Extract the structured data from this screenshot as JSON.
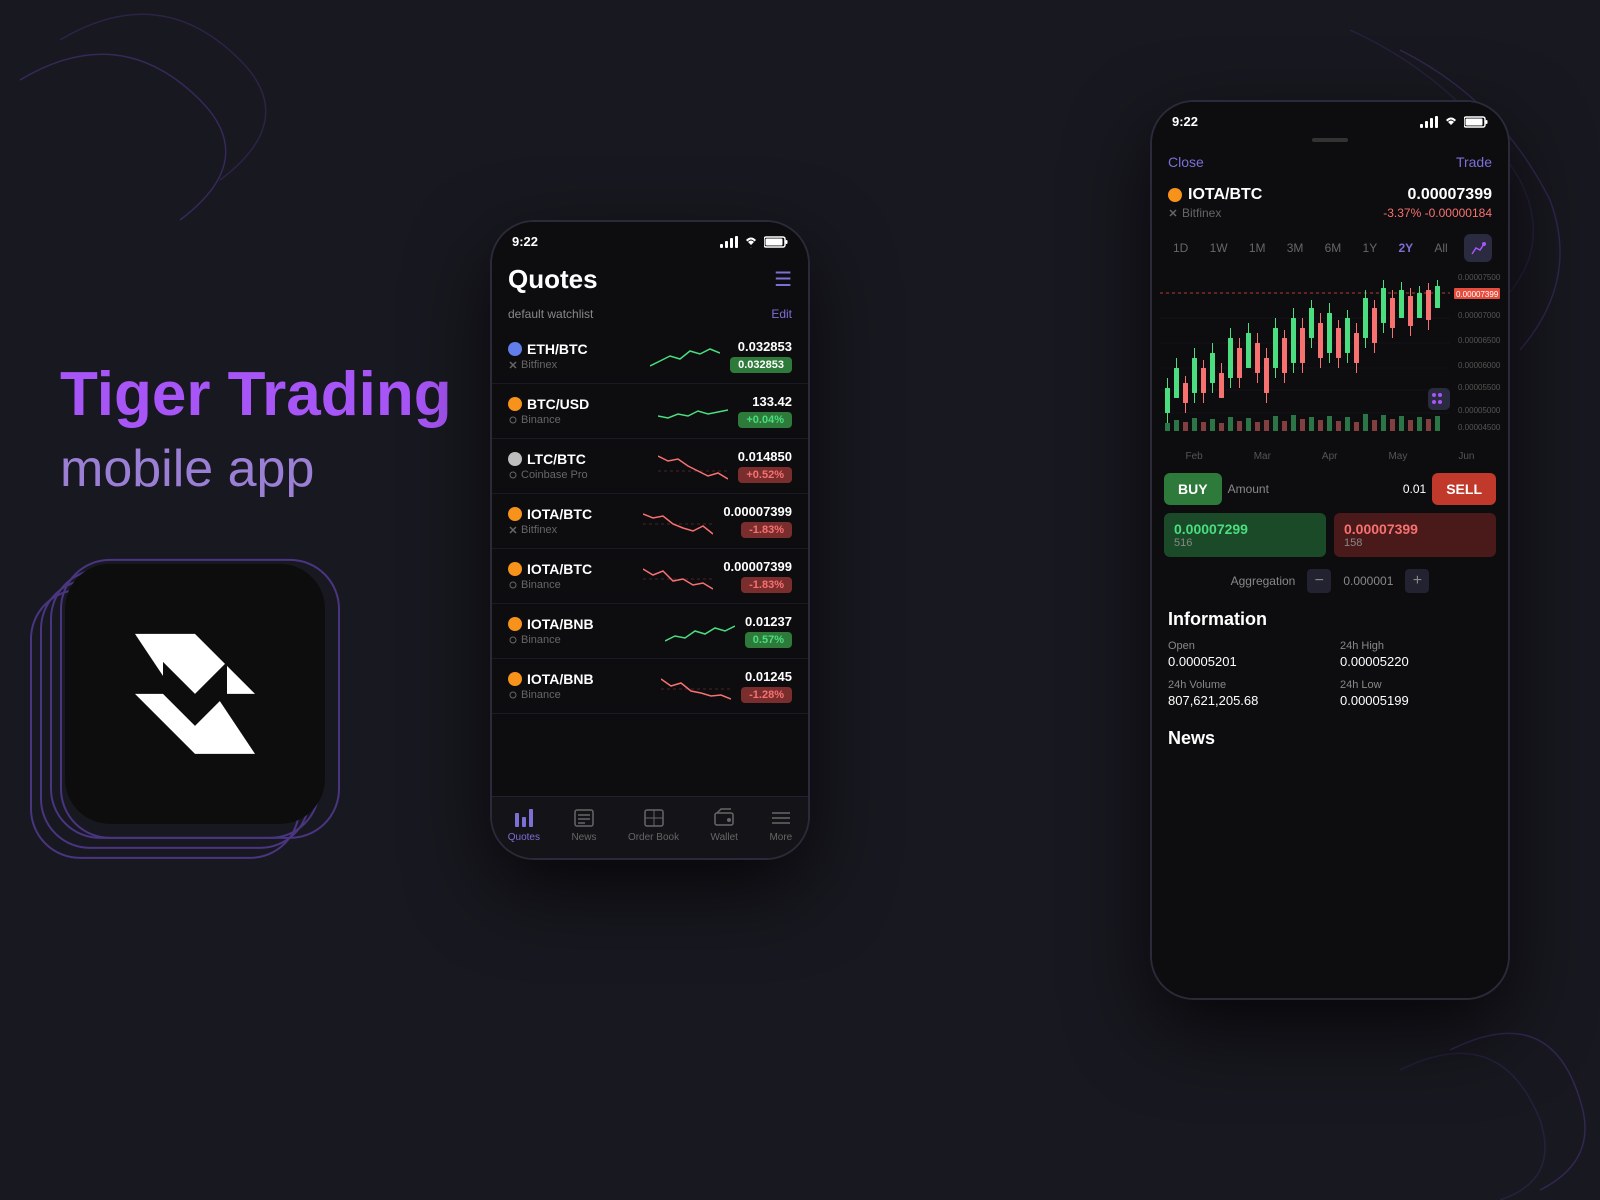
{
  "page": {
    "background": "#181820"
  },
  "branding": {
    "title_tiger": "Tiger Trading",
    "subtitle": "mobile app"
  },
  "phone1": {
    "status_time": "9:22",
    "screen_title": "Quotes",
    "watchlist_label": "default watchlist",
    "edit_label": "Edit",
    "quotes": [
      {
        "pair": "ETH/BTC",
        "exchange": "Bitfinex",
        "price": "0.032853",
        "change": "0.032853",
        "change_type": "green-flat",
        "coin_type": "eth"
      },
      {
        "pair": "BTC/USD",
        "exchange": "Binance",
        "price": "133.42",
        "change": "+0.04%",
        "change_type": "green",
        "coin_type": "btc"
      },
      {
        "pair": "LTC/BTC",
        "exchange": "Coinbase Pro",
        "price": "0.014850",
        "change": "+0.52%",
        "change_type": "red",
        "coin_type": "ltc"
      },
      {
        "pair": "IOTA/BTC",
        "exchange": "Bitfinex",
        "price": "0.00007399",
        "change": "-1.83%",
        "change_type": "red",
        "coin_type": "iota"
      },
      {
        "pair": "IOTA/BTC",
        "exchange": "Binance",
        "price": "0.00007399",
        "change": "-1.83%",
        "change_type": "red",
        "coin_type": "iota"
      },
      {
        "pair": "IOTA/BNB",
        "exchange": "Binance",
        "price": "0.01237",
        "change": "0.57%",
        "change_type": "green",
        "coin_type": "iota"
      },
      {
        "pair": "IOTA/BNB",
        "exchange": "Binance",
        "price": "0.01245",
        "change": "-1.28%",
        "change_type": "red",
        "coin_type": "iota"
      }
    ],
    "nav": [
      {
        "label": "Quotes",
        "active": true
      },
      {
        "label": "News",
        "active": false
      },
      {
        "label": "Order Book",
        "active": false
      },
      {
        "label": "Wallet",
        "active": false
      },
      {
        "label": "More",
        "active": false
      }
    ]
  },
  "phone2": {
    "status_time": "9:22",
    "close_label": "Close",
    "trade_label": "Trade",
    "coin_pair": "IOTA/BTC",
    "exchange": "Bitfinex",
    "price": "0.00007399",
    "change_pct": "-3.37%",
    "change_abs": "-0.00000184",
    "time_periods": [
      "1D",
      "1W",
      "1M",
      "3M",
      "6M",
      "1Y",
      "2Y",
      "All"
    ],
    "active_period": "2Y",
    "chart": {
      "price_labels": [
        "0.00007500",
        "0.00007399",
        "0.00007000",
        "0.00006500",
        "0.00006000",
        "0.00005500",
        "0.00005000",
        "0.00004500"
      ],
      "time_labels": [
        "Feb",
        "Mar",
        "Apr",
        "May",
        "Jun"
      ],
      "current_price_label": "0.00007399"
    },
    "buy_label": "BUY",
    "sell_label": "SELL",
    "amount_label": "Amount",
    "amount_value": "0.01",
    "bid_price": "0.00007299",
    "bid_qty": "516",
    "ask_price": "0.00007399",
    "ask_qty": "158",
    "aggregation_label": "Aggregation",
    "aggregation_value": "0.000001",
    "information_title": "Information",
    "open_label": "Open",
    "open_value": "0.00005201",
    "high_24h_label": "24h High",
    "high_24h_value": "0.00005220",
    "volume_24h_label": "24h Volume",
    "volume_24h_value": "807,621,205.68",
    "low_24h_label": "24h Low",
    "low_24h_value": "0.00005199",
    "news_title": "News"
  }
}
